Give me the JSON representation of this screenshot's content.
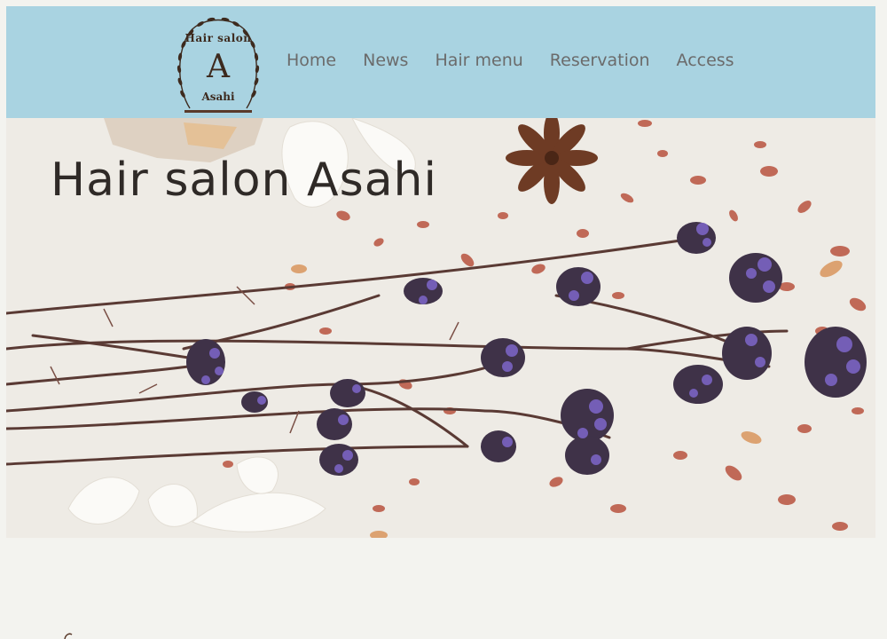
{
  "header": {
    "logo": {
      "top_text": "Hair salon",
      "letter": "A",
      "bottom_text": "Asahi",
      "icon": "laurel-wreath-icon"
    },
    "nav": [
      {
        "label": "Home"
      },
      {
        "label": "News"
      },
      {
        "label": "Hair menu"
      },
      {
        "label": "Reservation"
      },
      {
        "label": "Access"
      }
    ]
  },
  "hero": {
    "title": "Hair salon Asahi",
    "image": "dried-lavender-flowers-image"
  },
  "colors": {
    "header_bg": "#a9d3e1",
    "page_bg": "#f3f3ef",
    "nav_text": "#6b6b6b",
    "logo_brown": "#3d2a1e",
    "lavender": "#6b55a8",
    "stem": "#5a3a34",
    "petals": "#b8533f"
  }
}
